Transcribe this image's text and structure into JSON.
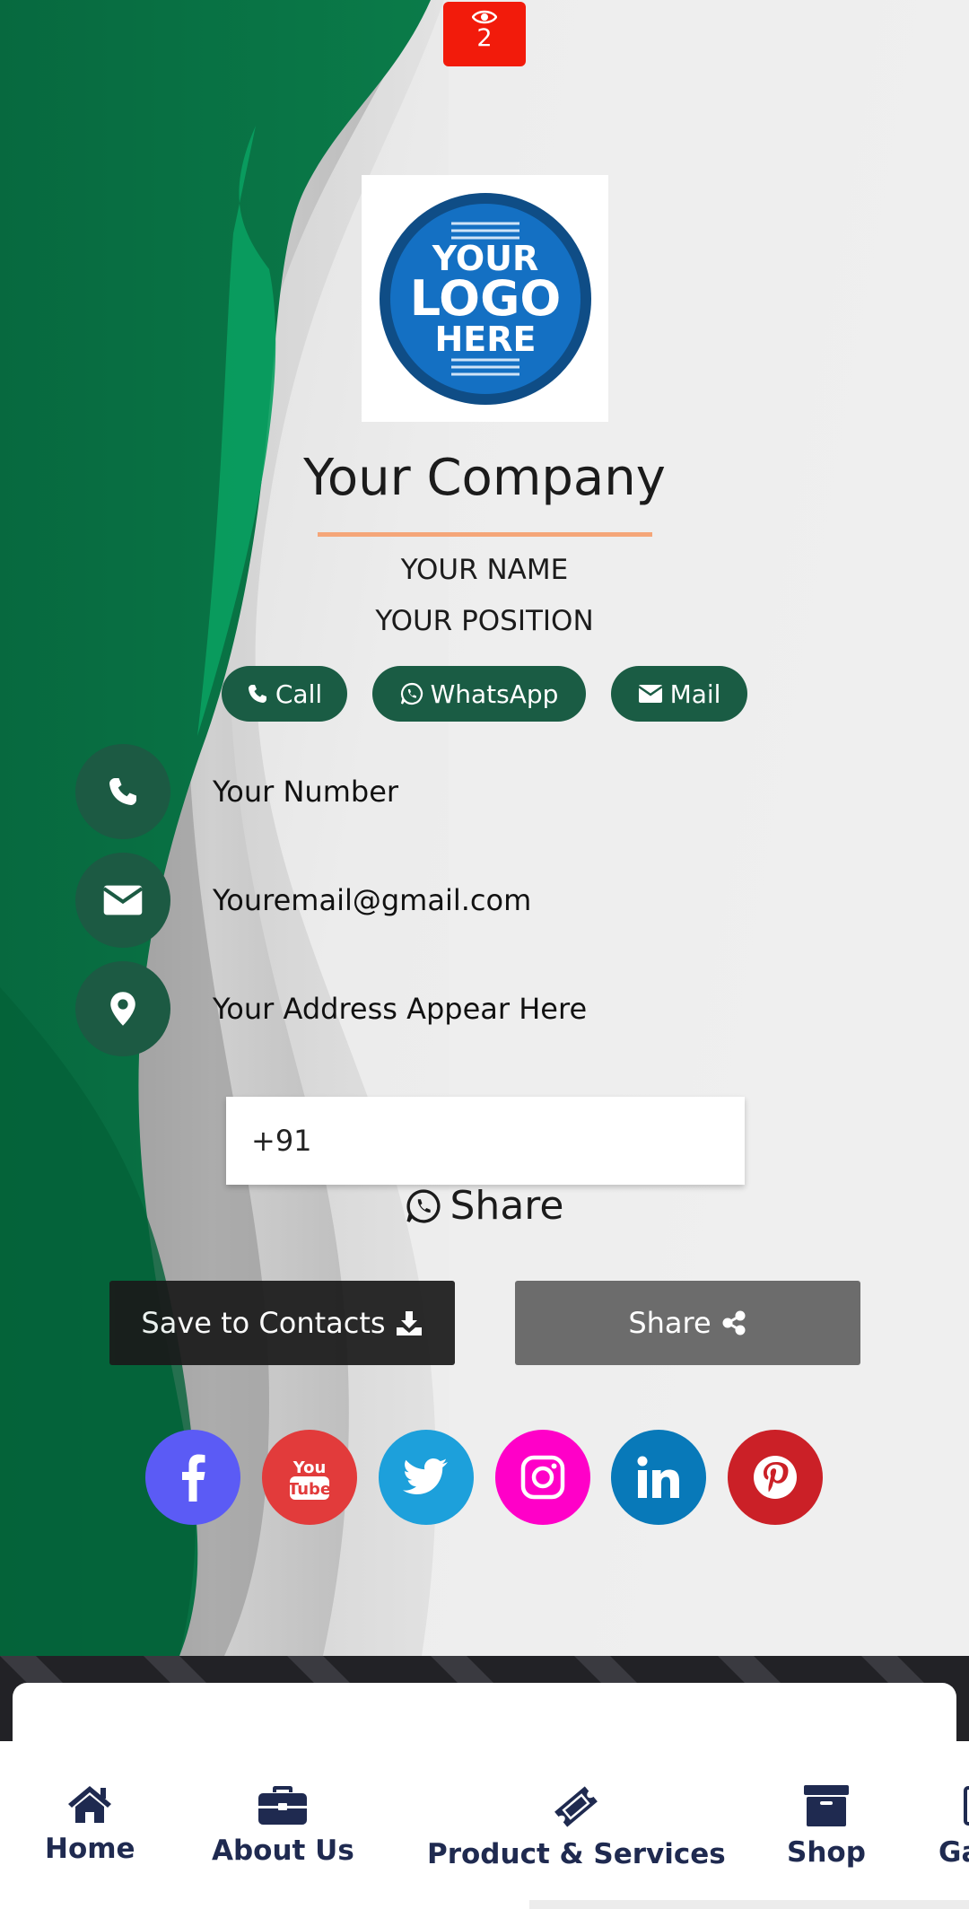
{
  "views": {
    "count": "2",
    "icon": "eye-icon"
  },
  "logo": {
    "line1": "YOUR",
    "line2": "LOGO",
    "line3": "HERE"
  },
  "profile": {
    "company": "Your Company",
    "name": "YOUR NAME",
    "position": "YOUR POSITION"
  },
  "quick_actions": {
    "call": "Call",
    "whatsapp": "WhatsApp",
    "mail": "Mail"
  },
  "contacts": {
    "phone": "Your Number",
    "email": "Youremail@gmail.com",
    "address": "Your Address Appear Here"
  },
  "whatsapp_share": {
    "input_value": "+91",
    "label": "Share"
  },
  "buttons": {
    "save": "Save to Contacts",
    "share": "Share"
  },
  "social": [
    {
      "name": "facebook",
      "color": "#5b5bf5"
    },
    {
      "name": "youtube",
      "color": "#e23b3b"
    },
    {
      "name": "twitter",
      "color": "#1da0db"
    },
    {
      "name": "instagram",
      "color": "#ff00c8"
    },
    {
      "name": "linkedin",
      "color": "#0879b9"
    },
    {
      "name": "pinterest",
      "color": "#cb2027"
    }
  ],
  "bottom_nav": {
    "home": "Home",
    "about": "About Us",
    "products": "Product & Services",
    "shop": "Shop",
    "gallery": "Ga"
  },
  "colors": {
    "accent_green": "#1a5c44",
    "badge_red": "#f21b0b",
    "rule_orange": "#f5a679",
    "nav_text": "#1f2a50"
  }
}
